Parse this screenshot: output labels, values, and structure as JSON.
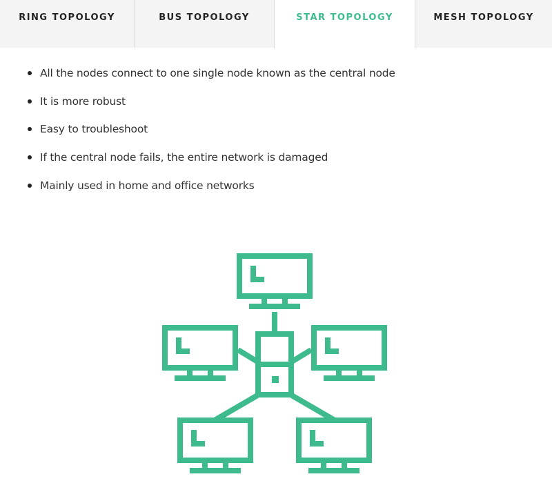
{
  "tabs": [
    {
      "label": "RING TOPOLOGY",
      "active": false
    },
    {
      "label": "BUS TOPOLOGY",
      "active": false
    },
    {
      "label": "STAR TOPOLOGY",
      "active": true
    },
    {
      "label": "MESH TOPOLOGY",
      "active": false
    }
  ],
  "content": {
    "points": [
      "All the nodes connect to one single node known as the central node",
      "It is more robust",
      "Easy to troubleshoot",
      "If the central node fails, the entire network is damaged",
      "Mainly used in home and office networks"
    ]
  },
  "diagram": {
    "icon": "star-topology-icon",
    "color": "#3dbb8c"
  },
  "colors": {
    "accent": "#3dbb8c",
    "tab_bg": "#f4f4f4",
    "border": "#dcdcdc"
  }
}
